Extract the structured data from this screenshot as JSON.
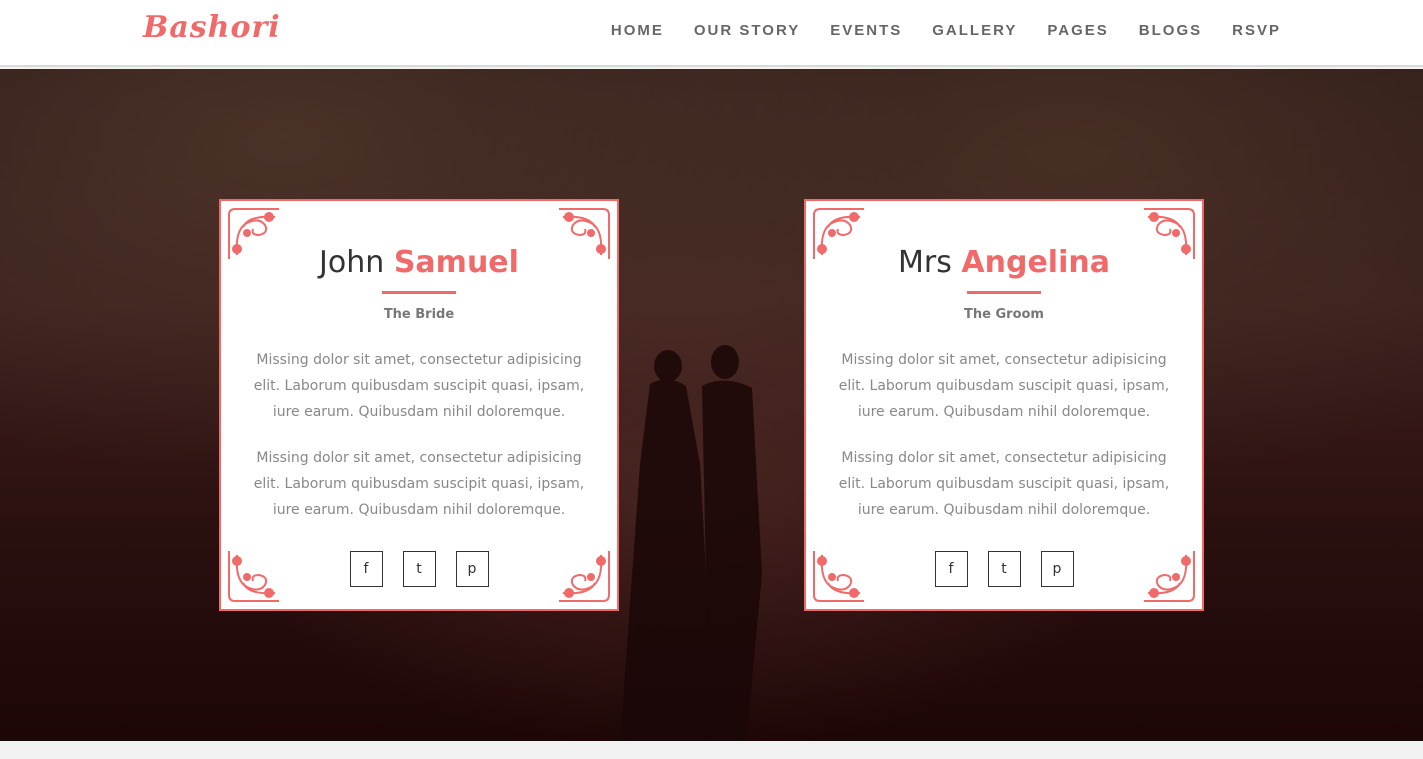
{
  "brand": {
    "logo": "Bashori",
    "accent": "#f16a6a"
  },
  "nav": {
    "items": [
      "HOME",
      "OUR STORY",
      "EVENTS",
      "GALLERY",
      "PAGES",
      "BLOGS",
      "RSVP"
    ]
  },
  "cards": [
    {
      "first": "John",
      "last": "Samuel",
      "role": "The Bride",
      "paragraphs": [
        "Missing dolor sit amet, consectetur adipisicing elit. Laborum quibusdam suscipit quasi, ipsam, iure earum. Quibusdam nihil doloremque.",
        "Missing dolor sit amet, consectetur adipisicing elit. Laborum quibusdam suscipit quasi, ipsam, iure earum. Quibusdam nihil doloremque."
      ],
      "socials": [
        "facebook-icon",
        "twitter-icon",
        "pinterest-icon"
      ]
    },
    {
      "first": "Mrs",
      "last": "Angelina",
      "role": "The Groom",
      "paragraphs": [
        "Missing dolor sit amet, consectetur adipisicing elit. Laborum quibusdam suscipit quasi, ipsam, iure earum. Quibusdam nihil doloremque.",
        "Missing dolor sit amet, consectetur adipisicing elit. Laborum quibusdam suscipit quasi, ipsam, iure earum. Quibusdam nihil doloremque."
      ],
      "socials": [
        "facebook-icon",
        "twitter-icon",
        "pinterest-icon"
      ]
    }
  ],
  "scroll_top": {
    "icon": "chevron-up-icon",
    "glyph": "⌃"
  },
  "social_glyphs": {
    "facebook": "f",
    "twitter": "t",
    "pinterest": "p"
  }
}
